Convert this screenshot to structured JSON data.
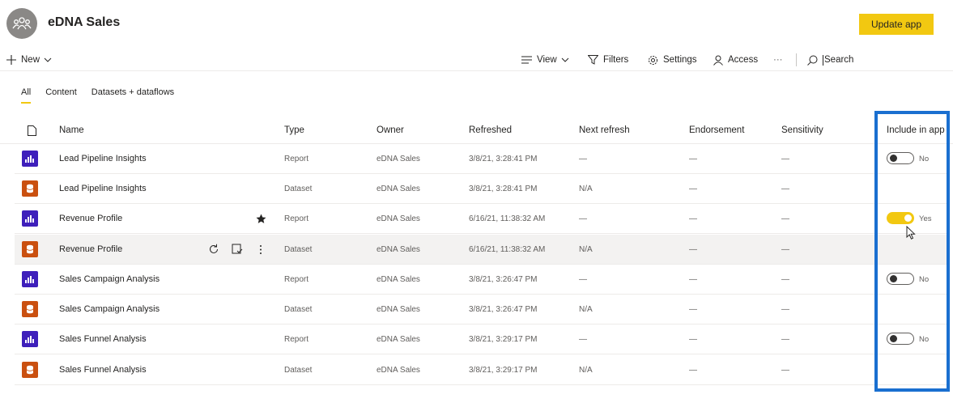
{
  "workspace": {
    "title": "eDNA Sales",
    "icon": "group-icon"
  },
  "header": {
    "update_app_label": "Update app"
  },
  "commandbar": {
    "new_label": "New",
    "view_label": "View",
    "filters_label": "Filters",
    "settings_label": "Settings",
    "access_label": "Access",
    "more_label": "···",
    "search_placeholder": "Search"
  },
  "tabs": [
    "All",
    "Content",
    "Datasets + dataflows"
  ],
  "columns": {
    "name": "Name",
    "type": "Type",
    "owner": "Owner",
    "refreshed": "Refreshed",
    "next_refresh": "Next refresh",
    "endorsement": "Endorsement",
    "sensitivity": "Sensitivity",
    "include_in_app": "Include in app"
  },
  "rows": [
    {
      "kind": "report",
      "name": "Lead Pipeline Insights",
      "type": "Report",
      "owner": "eDNA Sales",
      "refreshed": "3/8/21, 3:28:41 PM",
      "next_refresh": "—",
      "endorsement": "—",
      "sensitivity": "—",
      "include": "No"
    },
    {
      "kind": "dataset",
      "name": "Lead Pipeline Insights",
      "type": "Dataset",
      "owner": "eDNA Sales",
      "refreshed": "3/8/21, 3:28:41 PM",
      "next_refresh": "N/A",
      "endorsement": "—",
      "sensitivity": "—",
      "include": ""
    },
    {
      "kind": "report",
      "name": "Revenue Profile",
      "type": "Report",
      "owner": "eDNA Sales",
      "refreshed": "6/16/21, 11:38:32 AM",
      "next_refresh": "—",
      "endorsement": "—",
      "sensitivity": "—",
      "include": "Yes"
    },
    {
      "kind": "dataset",
      "name": "Revenue Profile",
      "type": "Dataset",
      "owner": "eDNA Sales",
      "refreshed": "6/16/21, 11:38:32 AM",
      "next_refresh": "N/A",
      "endorsement": "—",
      "sensitivity": "—",
      "include": ""
    },
    {
      "kind": "report",
      "name": "Sales Campaign Analysis",
      "type": "Report",
      "owner": "eDNA Sales",
      "refreshed": "3/8/21, 3:26:47 PM",
      "next_refresh": "—",
      "endorsement": "—",
      "sensitivity": "—",
      "include": "No"
    },
    {
      "kind": "dataset",
      "name": "Sales Campaign Analysis",
      "type": "Dataset",
      "owner": "eDNA Sales",
      "refreshed": "3/8/21, 3:26:47 PM",
      "next_refresh": "N/A",
      "endorsement": "—",
      "sensitivity": "—",
      "include": ""
    },
    {
      "kind": "report",
      "name": "Sales Funnel Analysis",
      "type": "Report",
      "owner": "eDNA Sales",
      "refreshed": "3/8/21, 3:29:17 PM",
      "next_refresh": "—",
      "endorsement": "—",
      "sensitivity": "—",
      "include": "No"
    },
    {
      "kind": "dataset",
      "name": "Sales Funnel Analysis",
      "type": "Dataset",
      "owner": "eDNA Sales",
      "refreshed": "3/8/21, 3:29:17 PM",
      "next_refresh": "N/A",
      "endorsement": "—",
      "sensitivity": "—",
      "include": ""
    }
  ],
  "colors": {
    "accent": "#f2c811",
    "report": "#3e1fbb",
    "dataset": "#ca5010",
    "highlight": "#1a6fd0"
  }
}
